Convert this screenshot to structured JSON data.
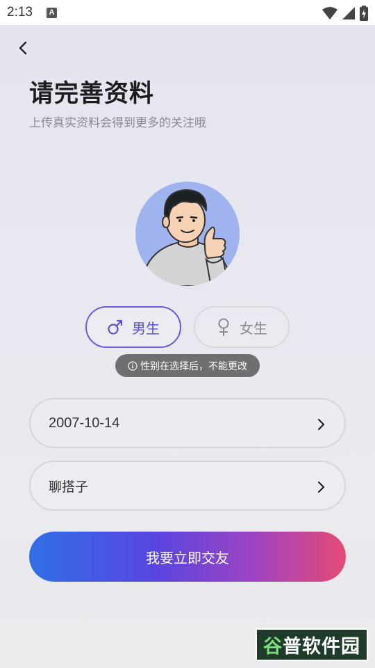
{
  "status_bar": {
    "time": "2:13",
    "notification_icon": "A"
  },
  "header": {
    "back_icon": "chevron-left-icon",
    "title": "请完善资料",
    "subtitle": "上传真实资料会得到更多的关注哦"
  },
  "gender": {
    "male_label": "男生",
    "female_label": "女生",
    "selected": "male",
    "tip": "性别在选择后，不能更改"
  },
  "fields": {
    "birthday": "2007-10-14",
    "purpose": "聊搭子"
  },
  "submit_label": "我要立即交友",
  "watermark": {
    "text_first": "谷",
    "text_rest": "普软件园"
  },
  "colors": {
    "accent": "#5a4fd6",
    "button_gradient_start": "#2f6fe6",
    "button_gradient_end": "#e64a74",
    "avatar_bg": "#9fb3ee"
  }
}
